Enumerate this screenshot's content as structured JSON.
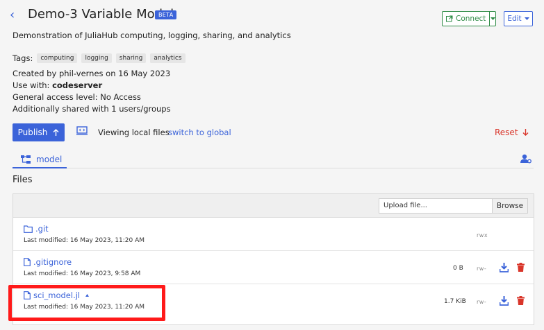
{
  "header": {
    "back_glyph": "‹",
    "title": "Demo-3 Variable Model",
    "badge": "BETA",
    "connect_label": "Connect",
    "edit_label": "Edit",
    "description": "Demonstration of JuliaHub computing, logging, sharing, and analytics"
  },
  "tags": {
    "label": "Tags:",
    "items": [
      "computing",
      "logging",
      "sharing",
      "analytics"
    ]
  },
  "meta": {
    "created_prefix": "Created by ",
    "created_by": "phil-vernes",
    "created_on_prefix": " on ",
    "created_on": "16 May 2023",
    "use_with_label": "Use with: ",
    "use_with_value": "codeserver",
    "access_label": "General access level: ",
    "access_value": "No Access",
    "shared_label": "Additionally shared with ",
    "shared_value": "1 users/groups"
  },
  "actions": {
    "publish_label": "Publish",
    "viewing_text": "Viewing local files",
    "switch_link": "switch to global",
    "reset_label": "Reset"
  },
  "tabs": [
    {
      "label": "model"
    }
  ],
  "files": {
    "heading": "Files",
    "upload_placeholder": "Upload file...",
    "browse_label": "Browse",
    "rows": [
      {
        "name": ".git",
        "modified": "Last modified: 16 May 2023, 11:20 AM",
        "size": "",
        "perm": "rwx",
        "type": "folder"
      },
      {
        "name": ".gitignore",
        "modified": "Last modified: 16 May 2023, 9:58 AM",
        "size": "0 B",
        "perm": "rw-",
        "type": "file"
      },
      {
        "name": "sci_model.jl",
        "modified": "Last modified: 16 May 2023, 11:20 AM",
        "size": "1.7 KiB",
        "perm": "rw-",
        "type": "file"
      }
    ]
  },
  "colors": {
    "accent": "#3b63d9",
    "connect": "#2e8b45",
    "danger": "#d9352a",
    "highlight": "#ff1a1a"
  }
}
